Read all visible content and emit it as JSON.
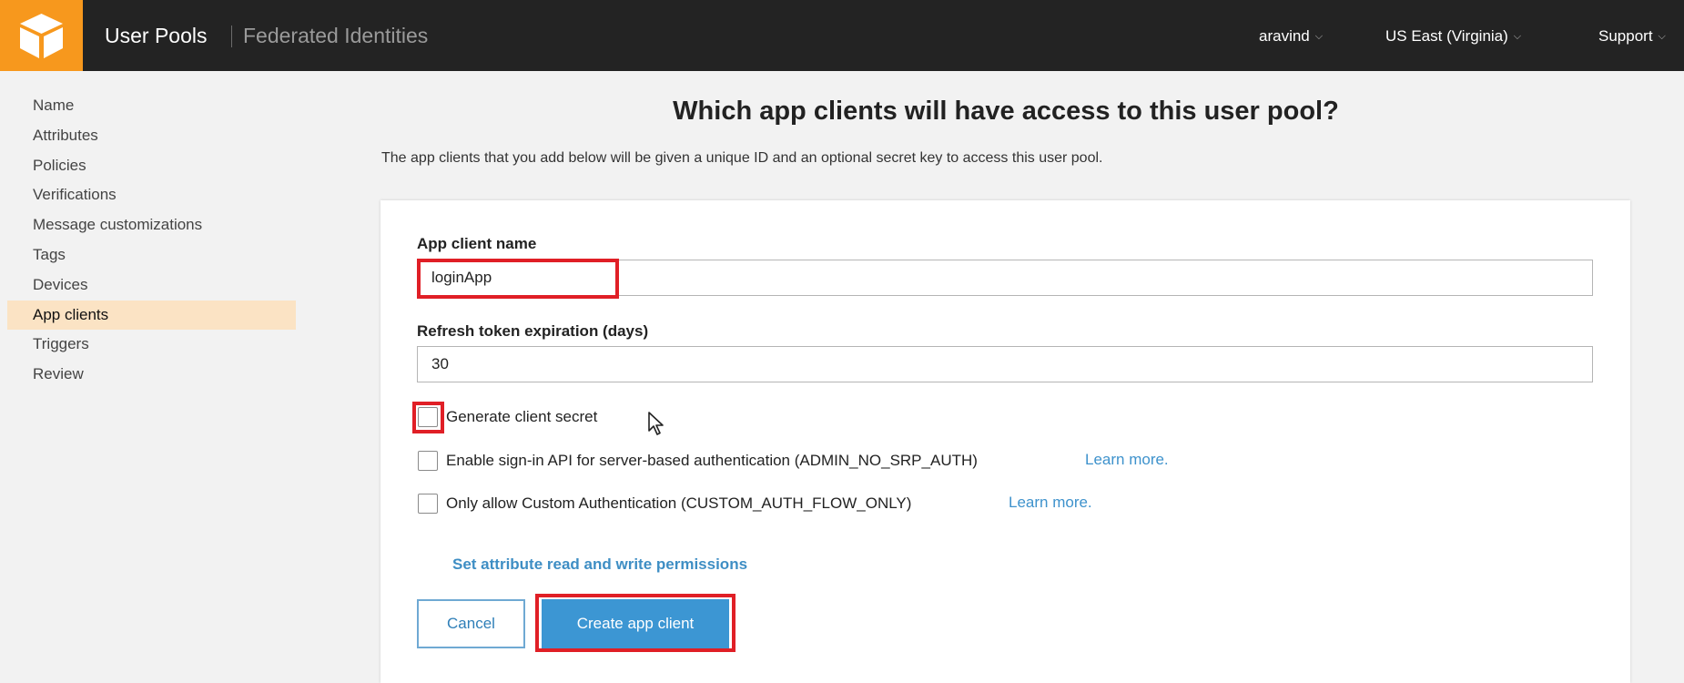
{
  "topbar": {
    "user_pools": "User Pools",
    "federated_identities": "Federated Identities",
    "account": "aravind",
    "region": "US East (Virginia)",
    "support": "Support",
    "chevron": "⌵"
  },
  "sidebar": {
    "items": [
      {
        "label": "Name"
      },
      {
        "label": "Attributes"
      },
      {
        "label": "Policies"
      },
      {
        "label": "Verifications"
      },
      {
        "label": "Message customizations"
      },
      {
        "label": "Tags"
      },
      {
        "label": "Devices"
      },
      {
        "label": "App clients"
      },
      {
        "label": "Triggers"
      },
      {
        "label": "Review"
      }
    ],
    "active": "App clients"
  },
  "main": {
    "heading": "Which app clients will have access to this user pool?",
    "subtext": "The app clients that you add below will be given a unique ID and an optional secret key to access this user pool.",
    "form": {
      "app_client_name_label": "App client name",
      "app_client_name_value": "loginApp",
      "refresh_label": "Refresh token expiration (days)",
      "refresh_value": "30",
      "checkboxes": [
        {
          "label": "Generate client secret",
          "checked": false
        },
        {
          "label": "Enable sign-in API for server-based authentication (ADMIN_NO_SRP_AUTH)",
          "checked": false,
          "link": "Learn more."
        },
        {
          "label": "Only allow Custom Authentication (CUSTOM_AUTH_FLOW_ONLY)",
          "checked": false,
          "link": "Learn more."
        }
      ],
      "permissions_link": "Set attribute read and write permissions",
      "cancel_label": "Cancel",
      "create_label": "Create app client"
    }
  },
  "colors": {
    "brand_orange": "#f7981d",
    "topbar": "#232323",
    "highlight_red": "#e01f26",
    "primary_blue": "#3c96d3",
    "link_blue": "#3e92cc",
    "active_sidebar": "#fbe3c4"
  }
}
